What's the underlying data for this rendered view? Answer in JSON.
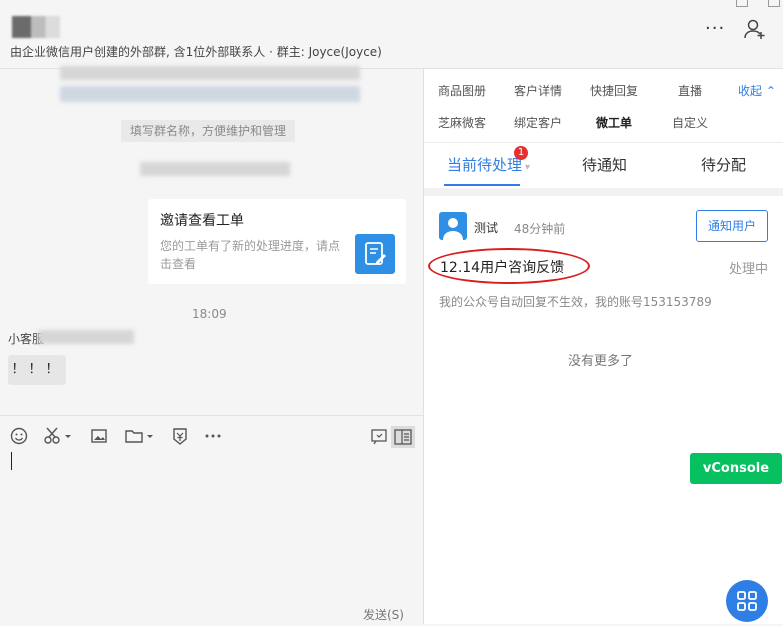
{
  "header": {
    "subtitle": "由企业微信用户创建的外部群, 含1位外部联系人 · 群主: Joyce(Joyce)",
    "more_label": "···"
  },
  "chat": {
    "system_tip": "填写群名称，方便维护和管理",
    "card": {
      "title": "邀请查看工单",
      "description": "您的工单有了新的处理进度，请点击查看"
    },
    "time": "18:09",
    "sender": "小客服",
    "message": "！！！"
  },
  "toolbar": {
    "send_label": "发送(S)"
  },
  "right_panel": {
    "nav_row1": [
      "商品图册",
      "客户详情",
      "快捷回复",
      "直播",
      "收起"
    ],
    "nav_row2": [
      "芝麻微客",
      "绑定客户",
      "微工单",
      "自定义"
    ],
    "tabs": [
      "当前待处理",
      "待通知",
      "待分配"
    ],
    "badge_count": "1",
    "ticket": {
      "user": "测试",
      "time_ago": "48分钟前",
      "notify_label": "通知用户",
      "title": "12.14用户咨询反馈",
      "status": "处理中",
      "description": "我的公众号自动回复不生效，我的账号153153789"
    },
    "no_more": "没有更多了",
    "vconsole_label": "vConsole"
  },
  "colors": {
    "accent": "#2f7ee5",
    "badge": "#e63030",
    "vconsole": "#07c160",
    "annotation": "#d81e1e"
  }
}
